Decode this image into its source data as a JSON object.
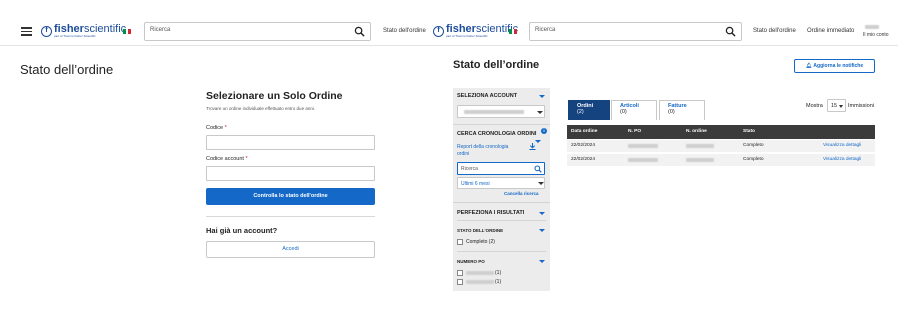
{
  "left": {
    "search_placeholder": "Ricerca",
    "nav_order_status": "Stato dell'ordine",
    "page_title": "Stato dell’ordine",
    "form": {
      "heading": "Selezionare un Solo Ordine",
      "subtitle": "Trovare un ordine individuale effettuato entro due anni.",
      "code_label": "Codice",
      "account_code_label": "Codice account",
      "required_mark": "*",
      "submit_label": "Controlla lo stato dell'ordine"
    },
    "account": {
      "heading": "Hai già un account?",
      "login_label": "Accedi"
    }
  },
  "brand": {
    "name_bold": "fisher",
    "name_light": "scientific",
    "tagline": "part of Thermo Fisher Scientific",
    "logo_letter": "f",
    "primary_color": "#1b4c9b",
    "button_color": "#1468c7"
  },
  "right": {
    "search_placeholder": "Ricerca",
    "nav_order_status": "Stato dell'ordine",
    "nav_immediate_order": "Ordine immediato",
    "nav_account": "Il mio conto",
    "page_title": "Stato dell’ordine",
    "notify_label": "Aggiorna le notifiche",
    "sidebar": {
      "select_account": "SELEZIONA ACCOUNT",
      "search_history": "CERCA CRONOLOGIA ORDINI",
      "report_link": "Report della cronologia ordini",
      "search_placeholder": "Ricerca",
      "period_value": "Ultimi 6 mesi",
      "clear_search": "Cancella ricerca",
      "refine": "PERFEZIONA I RISULTATI",
      "order_status_heading": "STATO DELL'ORDINE",
      "status_option": "Completo (2)",
      "po_heading": "NUMERO PO",
      "po_options": [
        "(1)",
        "(1)"
      ]
    },
    "tabs": [
      {
        "label": "Ordini",
        "count": "(2)"
      },
      {
        "label": "Articoli",
        "count": "(0)"
      },
      {
        "label": "Fatture",
        "count": "(0)"
      }
    ],
    "show_label": "Mostra",
    "show_value": "15",
    "entries_label": "Immissioni",
    "table": {
      "headers": [
        "Data ordine",
        "N. PO",
        "N. ordine",
        "Stato"
      ],
      "rows": [
        {
          "date": "22/02/2024",
          "status": "Completo",
          "action": "Visualizza dettagli"
        },
        {
          "date": "22/02/2024",
          "status": "Completo",
          "action": "Visualizza dettagli"
        }
      ]
    }
  }
}
